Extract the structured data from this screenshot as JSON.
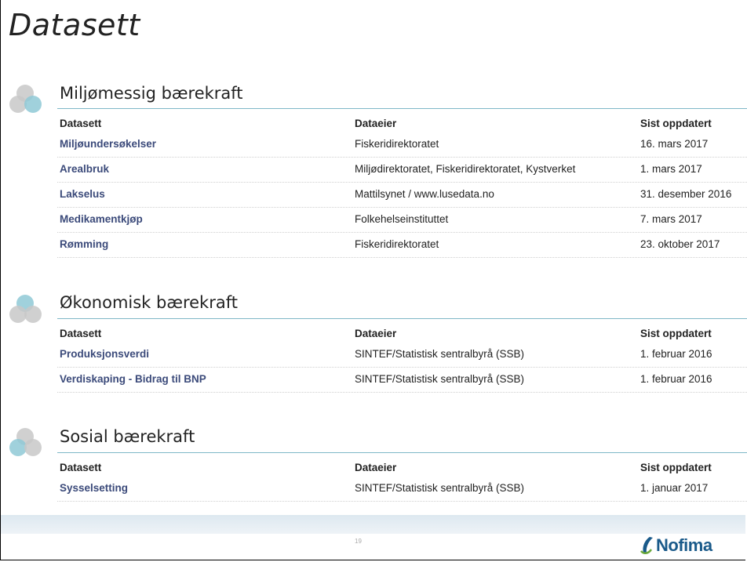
{
  "page": {
    "title": "Datasett",
    "page_number": "19",
    "logo_text": "Nofima"
  },
  "columns": {
    "dataset": "Datasett",
    "owner": "Dataeier",
    "updated": "Sist oppdatert"
  },
  "sections": [
    {
      "heading": "Miljømessig bærekraft",
      "rows": [
        {
          "name": "Miljøundersøkelser",
          "owner": "Fiskeridirektoratet",
          "updated": "16. mars 2017"
        },
        {
          "name": "Arealbruk",
          "owner": "Miljødirektoratet, Fiskeridirektoratet, Kystverket",
          "updated": "1. mars 2017"
        },
        {
          "name": "Lakselus",
          "owner": "Mattilsynet / www.lusedata.no",
          "updated": "31. desember 2016"
        },
        {
          "name": "Medikamentkjøp",
          "owner": "Folkehelseinstituttet",
          "updated": "7. mars 2017"
        },
        {
          "name": "Rømming",
          "owner": "Fiskeridirektoratet",
          "updated": "23. oktober 2017"
        }
      ]
    },
    {
      "heading": "Økonomisk bærekraft",
      "rows": [
        {
          "name": "Produksjonsverdi",
          "owner": "SINTEF/Statistisk sentralbyrå (SSB)",
          "updated": "1. februar 2016"
        },
        {
          "name": "Verdiskaping - Bidrag til BNP",
          "owner": "SINTEF/Statistisk sentralbyrå (SSB)",
          "updated": "1. februar 2016"
        }
      ]
    },
    {
      "heading": "Sosial bærekraft",
      "rows": [
        {
          "name": "Sysselsetting",
          "owner": "SINTEF/Statistisk sentralbyrå (SSB)",
          "updated": "1. januar 2017"
        }
      ]
    }
  ],
  "colors": {
    "link": "#3b4a7a",
    "rule": "#7fb8c7",
    "circle_gray": "#c8c8c8",
    "circle_teal": "#8fc9d6",
    "logo": "#1a5a8a"
  }
}
